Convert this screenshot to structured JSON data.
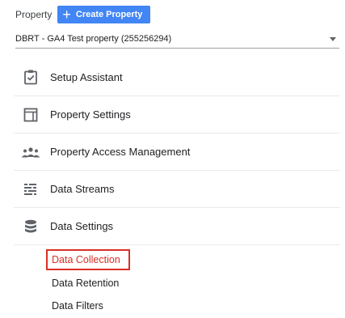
{
  "header": {
    "property_label": "Property",
    "create_button_icon": "plus-icon",
    "create_button_label": "Create Property"
  },
  "property_select": {
    "value": "DBRT - GA4 Test property (255256294)"
  },
  "menu": {
    "items": [
      {
        "label": "Setup Assistant",
        "icon": "clipboard-check-icon"
      },
      {
        "label": "Property Settings",
        "icon": "property-panel-icon"
      },
      {
        "label": "Property Access Management",
        "icon": "people-icon"
      },
      {
        "label": "Data Streams",
        "icon": "streams-icon"
      },
      {
        "label": "Data Settings",
        "icon": "database-icon"
      }
    ]
  },
  "data_settings_submenu": {
    "items": [
      {
        "label": "Data Collection",
        "active": true
      },
      {
        "label": "Data Retention",
        "active": false
      },
      {
        "label": "Data Filters",
        "active": false
      }
    ]
  },
  "colors": {
    "accent": "#4285f4",
    "highlight": "#d93025",
    "icon": "#5f6368",
    "divider": "#e8eaed"
  }
}
